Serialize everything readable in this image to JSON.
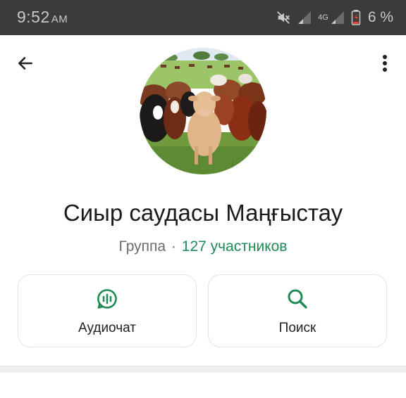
{
  "status_bar": {
    "time": "9:52",
    "ampm": "AM",
    "network": "4G",
    "battery_percent": "6 %",
    "icons": [
      "mute-icon",
      "signal-icon",
      "signal-4g-icon",
      "battery-icon"
    ]
  },
  "header": {
    "back_icon": "arrow-left-icon",
    "more_icon": "more-vertical-icon"
  },
  "group": {
    "name": "Сиыр саудасы Маңғыстау",
    "type": "Группа",
    "separator": "·",
    "members": "127 участников",
    "avatar": "cattle-herd-photo"
  },
  "actions": [
    {
      "label": "Аудиочат",
      "icon": "audio-chat-icon"
    },
    {
      "label": "Поиск",
      "icon": "search-icon"
    }
  ],
  "colors": {
    "status_bar_bg": "#3b3b3b",
    "accent": "#1f8a55",
    "text_primary": "#1b1b1b",
    "text_secondary": "#6b6b6b",
    "card_border": "#e3e3e3"
  }
}
